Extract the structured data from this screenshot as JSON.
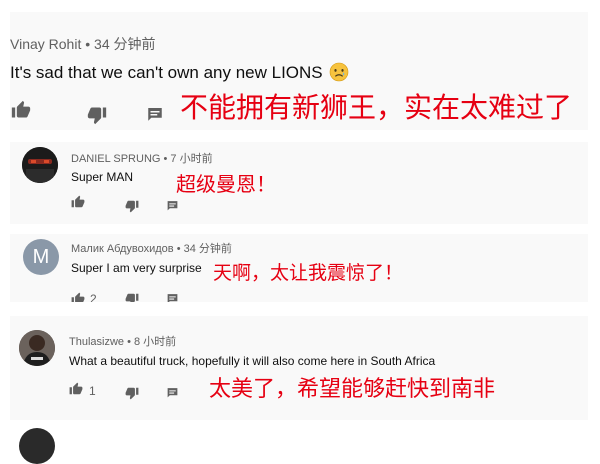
{
  "colors": {
    "background": "#ffffff",
    "panel": "#f9f9f9",
    "author_text": "#5f5f5f",
    "comment_text": "#0f0f0f",
    "icon": "#606060",
    "translation": "#e60012",
    "avatar_m": "#8a98a8"
  },
  "comments": [
    {
      "author": "Vinay Rohit",
      "time": "34 分钟前",
      "text": "It's sad that we can't own any new LIONS",
      "emoji": "😥",
      "translation": "不能拥有新狮王，实在太难过了"
    },
    {
      "author": "DANIEL SPRUNG",
      "time": "7 小时前",
      "text": "Super MAN",
      "translation": "超级曼恩！"
    },
    {
      "author": "Малик Абдувохидов",
      "time": "34 分钟前",
      "text": "Super I am very surprise",
      "translation": "天啊，太让我震惊了！",
      "avatar_letter": "M",
      "likes_partial": "2"
    },
    {
      "author": "Thulasizwe",
      "time": "8 小时前",
      "text": "What a beautiful truck, hopefully it will also come here in South Africa",
      "translation": "太美了，希望能够赶快到南非",
      "likes": "1"
    }
  ],
  "icons": {
    "like": "thumbs-up-icon",
    "dislike": "thumbs-down-icon",
    "reply": "reply-icon",
    "emoji": "sad-face-emoji"
  }
}
